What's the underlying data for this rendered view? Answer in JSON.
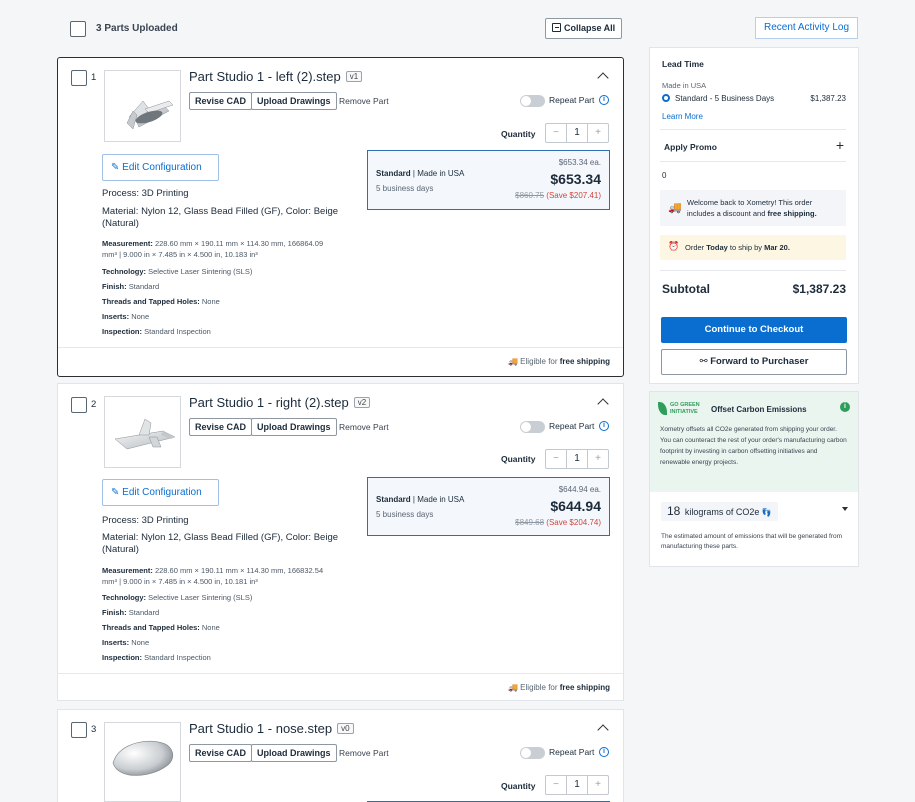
{
  "header": {
    "parts_uploaded": "3 Parts Uploaded",
    "collapse_all": "Collapse All",
    "recent_activity": "Recent Activity Log"
  },
  "parts": [
    {
      "index": "1",
      "name": "Part Studio 1 - left (2).step",
      "version": "v1",
      "revise_cad": "Revise CAD",
      "upload_drawings": "Upload Drawings",
      "remove_part": "Remove Part",
      "repeat_part": "Repeat Part",
      "quantity_label": "Quantity",
      "quantity": "1",
      "edit_config": "Edit Configuration",
      "price_tier": "Standard",
      "price_origin": "Made in USA",
      "price_days": "5 business days",
      "price_each": "$653.34 ea.",
      "price_total": "$653.34",
      "price_original": "$860.75",
      "price_save": "(Save $207.41)",
      "process": "Process: 3D Printing",
      "material": "Material: Nylon 12, Glass Bead Filled (GF), Color: Beige (Natural)",
      "measurement_label": "Measurement:",
      "measurement": "228.60 mm × 190.11 mm × 114.30 mm, 166864.09 mm³  |  9.000 in × 7.485 in × 4.500 in, 10.183 in³",
      "technology_label": "Technology:",
      "technology": "Selective Laser Sintering (SLS)",
      "finish_label": "Finish:",
      "finish": "Standard",
      "threads_label": "Threads and Tapped Holes:",
      "threads": "None",
      "inserts_label": "Inserts:",
      "inserts": "None",
      "inspection_label": "Inspection:",
      "inspection": "Standard Inspection",
      "shipping_prefix": "Eligible for",
      "shipping_bold": "free shipping"
    },
    {
      "index": "2",
      "name": "Part Studio 1 - right (2).step",
      "version": "v2",
      "revise_cad": "Revise CAD",
      "upload_drawings": "Upload Drawings",
      "remove_part": "Remove Part",
      "repeat_part": "Repeat Part",
      "quantity_label": "Quantity",
      "quantity": "1",
      "edit_config": "Edit Configuration",
      "price_tier": "Standard",
      "price_origin": "Made in USA",
      "price_days": "5 business days",
      "price_each": "$644.94 ea.",
      "price_total": "$644.94",
      "price_original": "$849.68",
      "price_save": "(Save $204.74)",
      "process": "Process: 3D Printing",
      "material": "Material: Nylon 12, Glass Bead Filled (GF), Color: Beige (Natural)",
      "measurement_label": "Measurement:",
      "measurement": "228.60 mm × 190.11 mm × 114.30 mm, 166832.54 mm³  |  9.000 in × 7.485 in × 4.500 in, 10.181 in³",
      "technology_label": "Technology:",
      "technology": "Selective Laser Sintering (SLS)",
      "finish_label": "Finish:",
      "finish": "Standard",
      "threads_label": "Threads and Tapped Holes:",
      "threads": "None",
      "inserts_label": "Inserts:",
      "inserts": "None",
      "inspection_label": "Inspection:",
      "inspection": "Standard Inspection",
      "shipping_prefix": "Eligible for",
      "shipping_bold": "free shipping"
    },
    {
      "index": "3",
      "name": "Part Studio 1 - nose.step",
      "version": "v0",
      "revise_cad": "Revise CAD",
      "upload_drawings": "Upload Drawings",
      "remove_part": "Remove Part",
      "repeat_part": "Repeat Part",
      "quantity_label": "Quantity",
      "quantity": "1"
    }
  ],
  "sidebar": {
    "lead_time_title": "Lead Time",
    "made_in": "Made in USA",
    "option_label": "Standard - 5 Business Days",
    "option_price": "$1,387.23",
    "learn_more": "Learn More",
    "apply_promo": "Apply Promo",
    "promo_value": "0",
    "welcome_pre": "Welcome back to Xometry! This order includes a discount and",
    "welcome_bold": "free shipping.",
    "order_pre": "Order",
    "order_today": "Today",
    "order_mid": "to ship by",
    "order_date": "Mar 20.",
    "subtotal_label": "Subtotal",
    "subtotal_value": "$1,387.23",
    "checkout": "Continue to Checkout",
    "forward": "Forward to Purchaser"
  },
  "green": {
    "logo_line1": "GO GREEN",
    "logo_line2": "INITIATIVE",
    "title": "Offset Carbon Emissions",
    "description": "Xometry offsets all CO2e generated from shipping your order. You can counteract the rest of your order's manufacturing carbon footprint by investing in carbon offsetting initiatives and renewable energy projects.",
    "kg_value": "18",
    "kg_unit": "kilograms of CO2e",
    "footnote": "The estimated amount of emissions that will be generated from manufacturing these parts."
  },
  "colors": {
    "primary": "#0a6ed1",
    "price_border": "#2f6cb3",
    "save_red": "#d0453a",
    "green_bg": "#eaf5ef",
    "order_bg": "#fdf6e3"
  }
}
